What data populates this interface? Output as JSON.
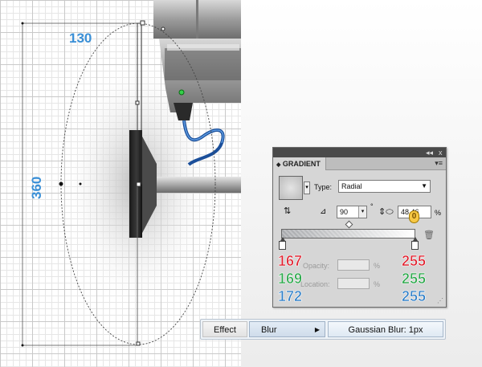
{
  "canvas": {
    "dimension_width": "130",
    "dimension_height": "360"
  },
  "panel": {
    "tab_title": "GRADIENT",
    "collapse_icon": "◂◂",
    "close_icon": "x",
    "menu_icon": "▾≡",
    "type_label": "Type:",
    "type_value": "Radial",
    "angle_value": "90",
    "degree_mark": "°",
    "aspect_value": "48.46",
    "percent_mark": "%",
    "opacity_label": "Opacity:",
    "location_label": "Location:",
    "badge_value": "0",
    "left_stop_rgb": {
      "r": "167",
      "g": "169",
      "b": "172"
    },
    "right_stop_rgb": {
      "r": "255",
      "g": "255",
      "b": "255"
    },
    "colors": {
      "red": "#e0202e",
      "green": "#2aa84a",
      "blue": "#2f7fc8"
    }
  },
  "breadcrumbs": {
    "effect": "Effect",
    "blur": "Blur",
    "gaussian": "Gaussian Blur: 1px"
  }
}
